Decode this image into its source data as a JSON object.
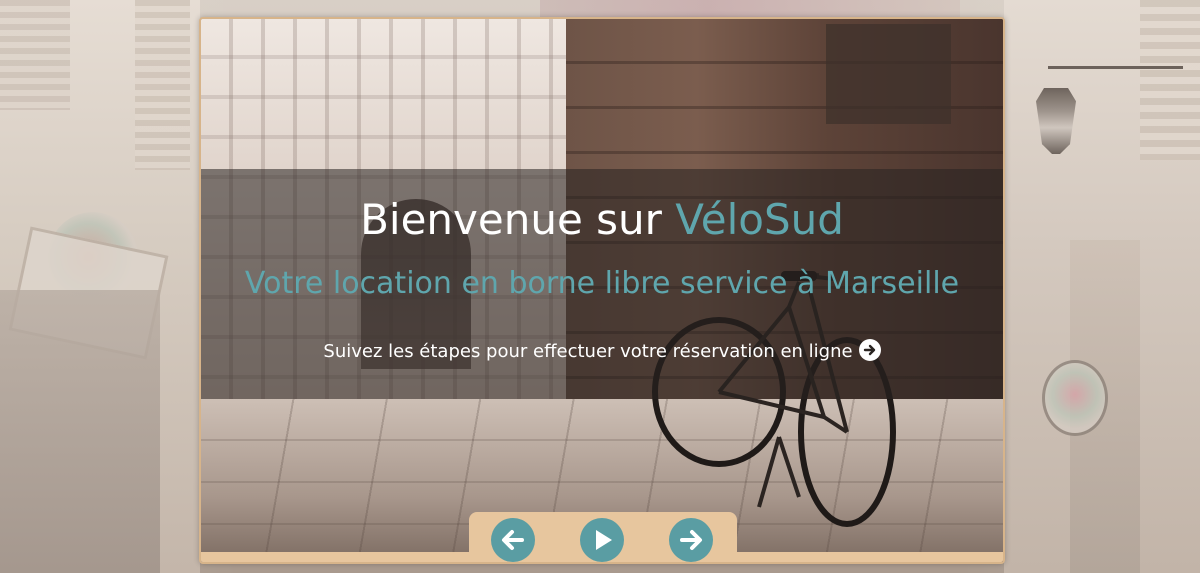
{
  "hero": {
    "headline_prefix": "Bienvenue sur ",
    "headline_brand": "VéloSud",
    "subheadline": "Votre location en borne libre service à Marseille",
    "instruction": "Suivez les étapes pour effectuer votre réservation en ligne"
  },
  "controls": {
    "prev_icon": "arrow-left-icon",
    "play_icon": "play-icon",
    "next_icon": "arrow-right-icon"
  },
  "colors": {
    "accent": "#5fa6ad",
    "button": "#5a9da3",
    "frame": "#e7c69e"
  }
}
